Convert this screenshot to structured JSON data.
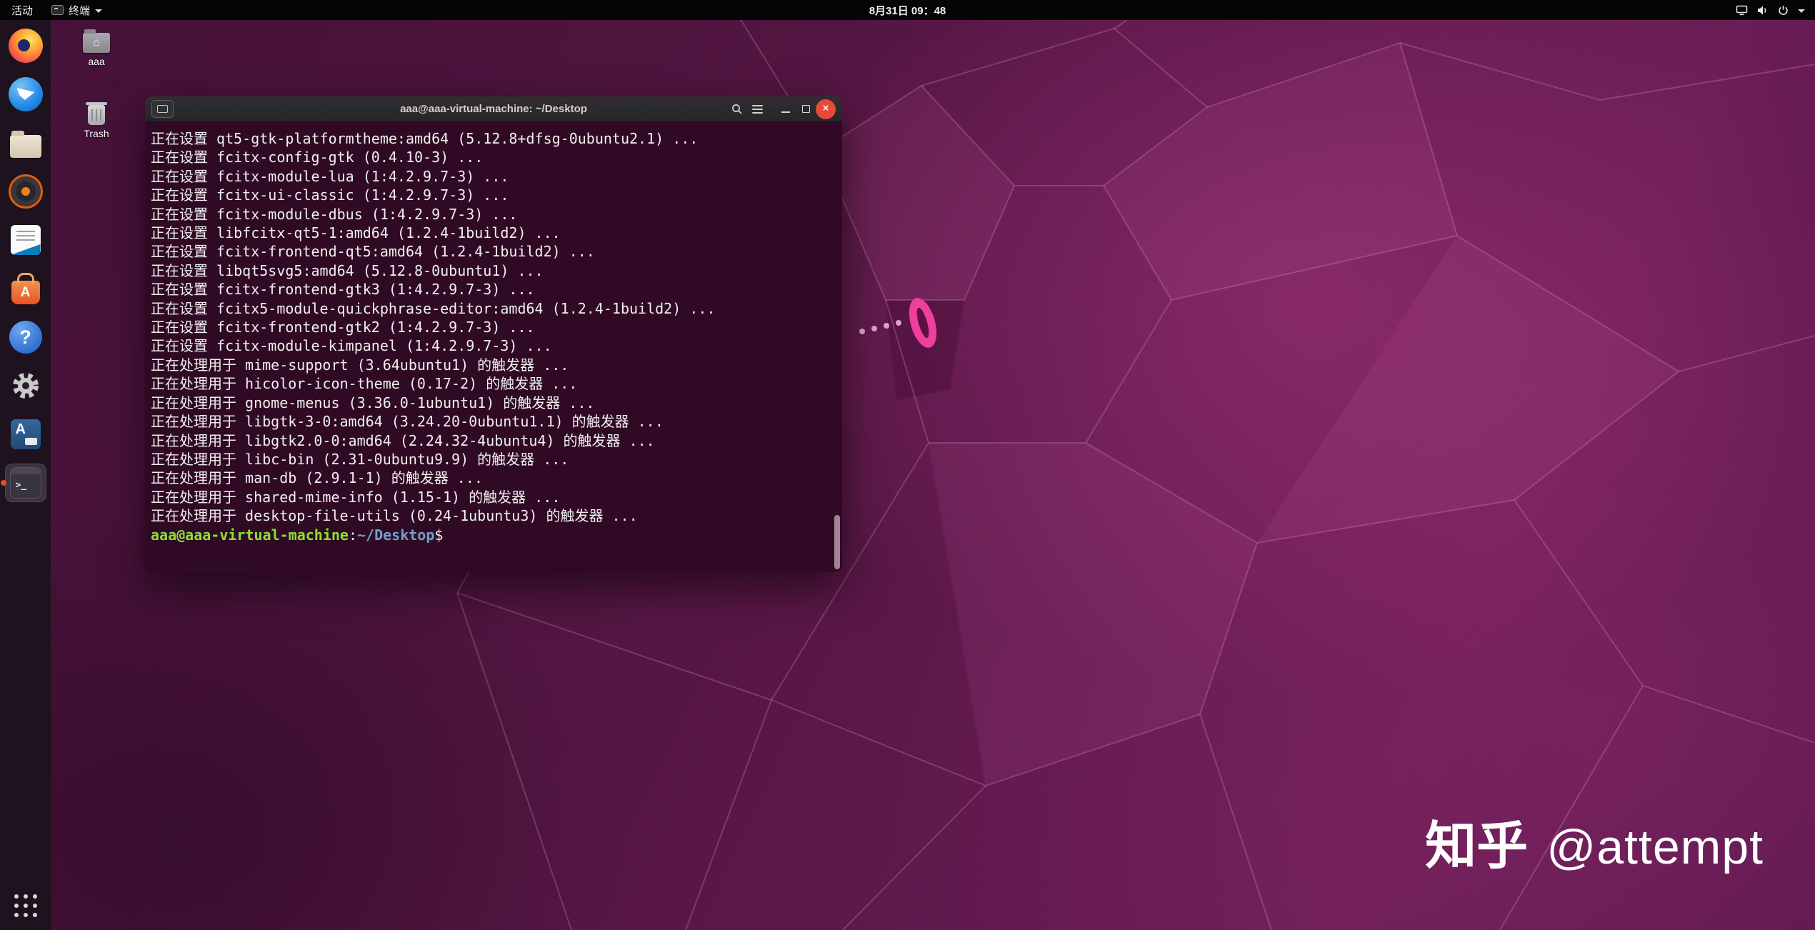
{
  "topbar": {
    "activities_label": "活动",
    "app_indicator_label": "终端",
    "clock": "8月31日 09：48"
  },
  "dock": {
    "items": [
      {
        "name": "firefox"
      },
      {
        "name": "thunderbird"
      },
      {
        "name": "files"
      },
      {
        "name": "rhythmbox"
      },
      {
        "name": "libreoffice-writer"
      },
      {
        "name": "ubuntu-software"
      },
      {
        "name": "help"
      },
      {
        "name": "settings"
      },
      {
        "name": "input-method"
      },
      {
        "name": "terminal",
        "active": true
      }
    ]
  },
  "desktop": {
    "icons": [
      {
        "label": "aaa"
      },
      {
        "label": "Trash"
      }
    ],
    "watermark": {
      "brand": "知乎",
      "handle": "@attempt"
    }
  },
  "terminal_window": {
    "title": "aaa@aaa-virtual-machine: ~/Desktop",
    "lines": [
      "正在设置 qt5-gtk-platformtheme:amd64 (5.12.8+dfsg-0ubuntu2.1) ...",
      "正在设置 fcitx-config-gtk (0.4.10-3) ...",
      "正在设置 fcitx-module-lua (1:4.2.9.7-3) ...",
      "正在设置 fcitx-ui-classic (1:4.2.9.7-3) ...",
      "正在设置 fcitx-module-dbus (1:4.2.9.7-3) ...",
      "正在设置 libfcitx-qt5-1:amd64 (1.2.4-1build2) ...",
      "正在设置 fcitx-frontend-qt5:amd64 (1.2.4-1build2) ...",
      "正在设置 libqt5svg5:amd64 (5.12.8-0ubuntu1) ...",
      "正在设置 fcitx-frontend-gtk3 (1:4.2.9.7-3) ...",
      "正在设置 fcitx5-module-quickphrase-editor:amd64 (1.2.4-1build2) ...",
      "正在设置 fcitx-frontend-gtk2 (1:4.2.9.7-3) ...",
      "正在设置 fcitx-module-kimpanel (1:4.2.9.7-3) ...",
      "正在处理用于 mime-support (3.64ubuntu1) 的触发器 ...",
      "正在处理用于 hicolor-icon-theme (0.17-2) 的触发器 ...",
      "正在处理用于 gnome-menus (3.36.0-1ubuntu1) 的触发器 ...",
      "正在处理用于 libgtk-3-0:amd64 (3.24.20-0ubuntu1.1) 的触发器 ...",
      "正在处理用于 libgtk2.0-0:amd64 (2.24.32-4ubuntu4) 的触发器 ...",
      "正在处理用于 libc-bin (2.31-0ubuntu9.9) 的触发器 ...",
      "正在处理用于 man-db (2.9.1-1) 的触发器 ...",
      "正在处理用于 shared-mime-info (1.15-1) 的触发器 ...",
      "正在处理用于 desktop-file-utils (0.24-1ubuntu3) 的触发器 ..."
    ],
    "prompt": {
      "user_host": "aaa@aaa-virtual-machine",
      "separator": ":",
      "path": "~/Desktop",
      "symbol": "$"
    }
  },
  "colors": {
    "terminal_bg": "#300a24",
    "prompt_green": "#8ae234",
    "prompt_blue": "#729fcf",
    "close_button": "#e64b3a",
    "dock_indicator": "#e8491f"
  }
}
